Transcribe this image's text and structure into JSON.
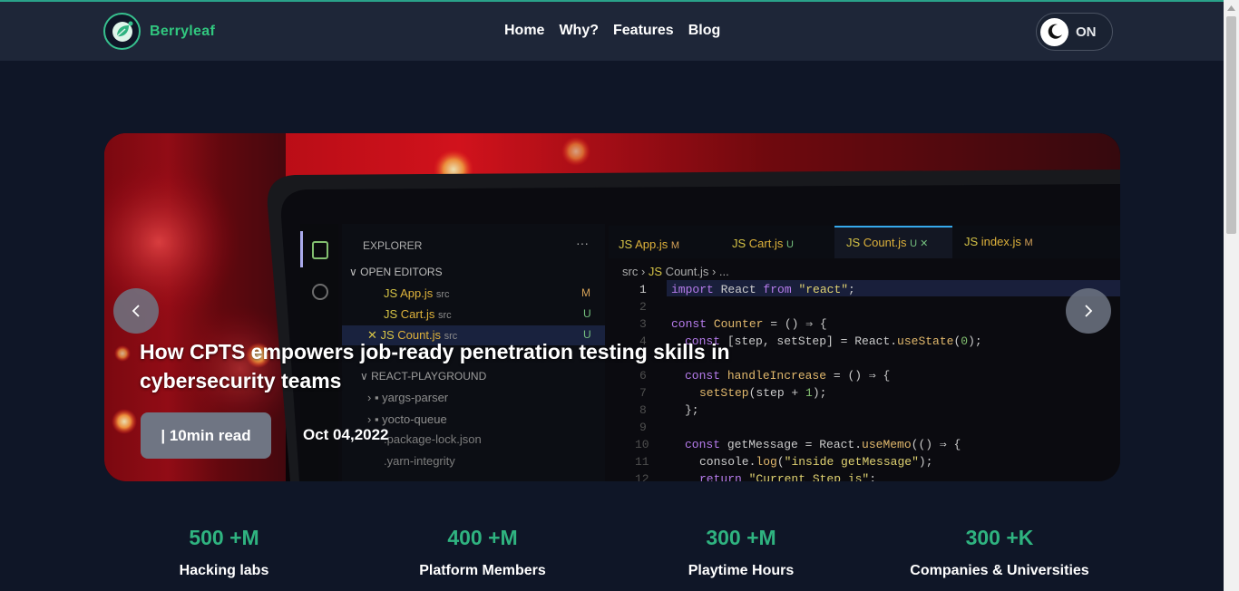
{
  "brand": {
    "name": "Berryleaf",
    "accent": "#31c77f"
  },
  "nav": {
    "links": [
      "Home",
      "Why?",
      "Features",
      "Blog"
    ]
  },
  "theme_toggle": {
    "label": "ON",
    "icon": "moon-icon"
  },
  "hero": {
    "title": "How CPTS empowers job-ready penetration testing skills in cybersecurity teams",
    "read_time": "| 10min read",
    "date": "Oct 04,2022",
    "prev_icon": "chevron-left-icon",
    "next_icon": "chevron-right-icon"
  },
  "stats": [
    {
      "value": "500 +M",
      "label": "Hacking labs"
    },
    {
      "value": "400 +M",
      "label": "Platform Members"
    },
    {
      "value": "300 +M",
      "label": "Playtime Hours"
    },
    {
      "value": "300 +K",
      "label": "Companies & Universities"
    }
  ],
  "colors": {
    "background": "#0f1627",
    "navbar": "#1e2638",
    "stat_value": "#2fb380"
  }
}
